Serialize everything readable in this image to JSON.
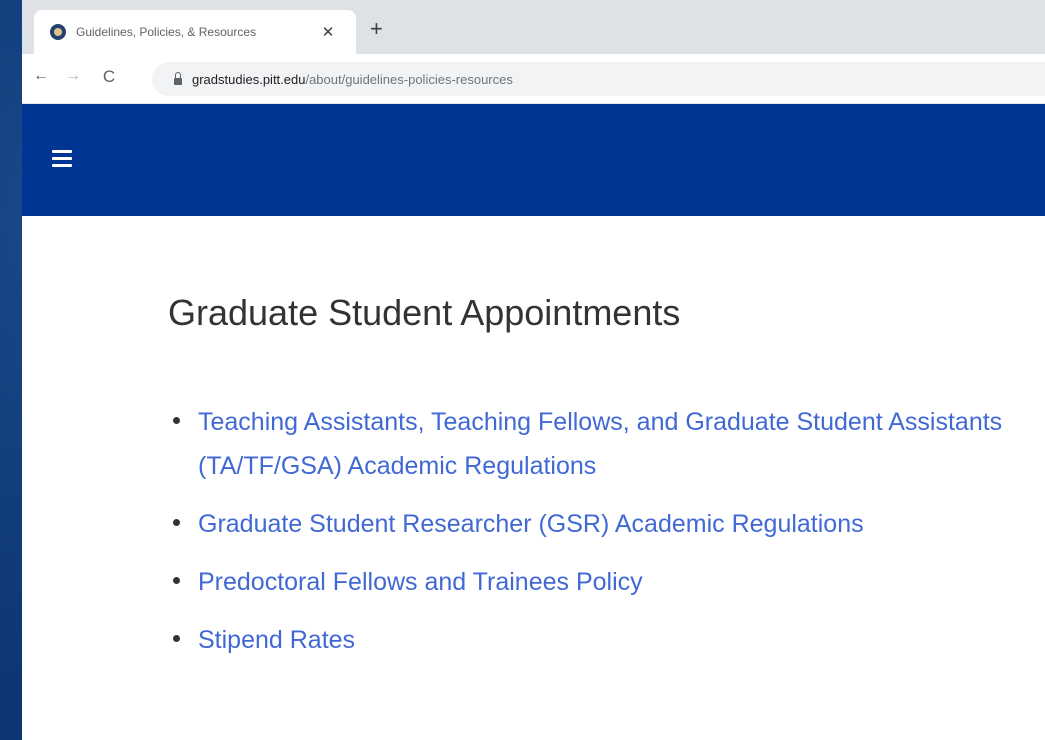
{
  "browser": {
    "tab": {
      "title": "Guidelines, Policies, & Resources",
      "close_glyph": "✕",
      "favicon": "pitt-seal-icon"
    },
    "new_tab_glyph": "+",
    "nav": {
      "back_glyph": "←",
      "forward_glyph": "→",
      "reload_glyph": "C"
    },
    "address": {
      "host": "gradstudies.pitt.edu",
      "path": "/about/guidelines-policies-resources"
    }
  },
  "header": {
    "background_color": "#003594",
    "menu_icon": "hamburger-menu-icon"
  },
  "main": {
    "heading": "Graduate Student Appointments",
    "links": [
      {
        "label": "Teaching Assistants, Teaching Fellows, and Graduate Student Assistants (TA/TF/GSA) Academic Regulations"
      },
      {
        "label": "Graduate Student Researcher (GSR) Academic Regulations"
      },
      {
        "label": "Predoctoral Fellows and Trainees Policy"
      },
      {
        "label": "Stipend Rates"
      }
    ],
    "link_color": "#4169d6"
  }
}
